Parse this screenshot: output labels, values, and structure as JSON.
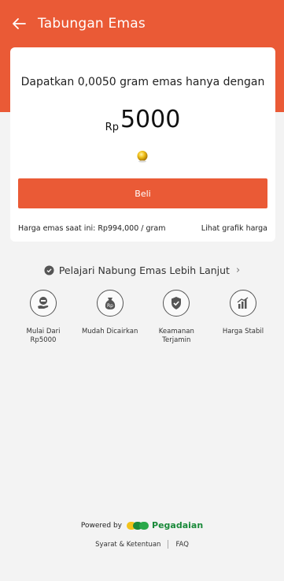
{
  "header": {
    "title": "Tabungan Emas",
    "back_icon": "arrow-left-icon",
    "color": "#ea5a36"
  },
  "card": {
    "promo": "Dapatkan 0,0050 gram emas hanya dengan",
    "currency": "Rp",
    "amount": "5000",
    "buy_label": "Beli",
    "current_price": "Harga emas saat ini: Rp994,000 / gram",
    "chart_link": "Lihat grafik harga"
  },
  "learn_more": {
    "label": "Pelajari Nabung Emas Lebih Lanjut",
    "icon": "shield-check-icon"
  },
  "features": [
    {
      "label": "Mulai Dari Rp5000",
      "icon": "coin-hand-icon"
    },
    {
      "label": "Mudah Dicairkan",
      "icon": "money-bag-icon"
    },
    {
      "label": "Keamanan Terjamin",
      "icon": "shield-icon"
    },
    {
      "label": "Harga Stabil",
      "icon": "bar-chart-icon"
    }
  ],
  "footer": {
    "powered_by": "Powered by",
    "brand": "Pegadaian",
    "terms": "Syarat & Ketentuan",
    "faq": "FAQ"
  }
}
